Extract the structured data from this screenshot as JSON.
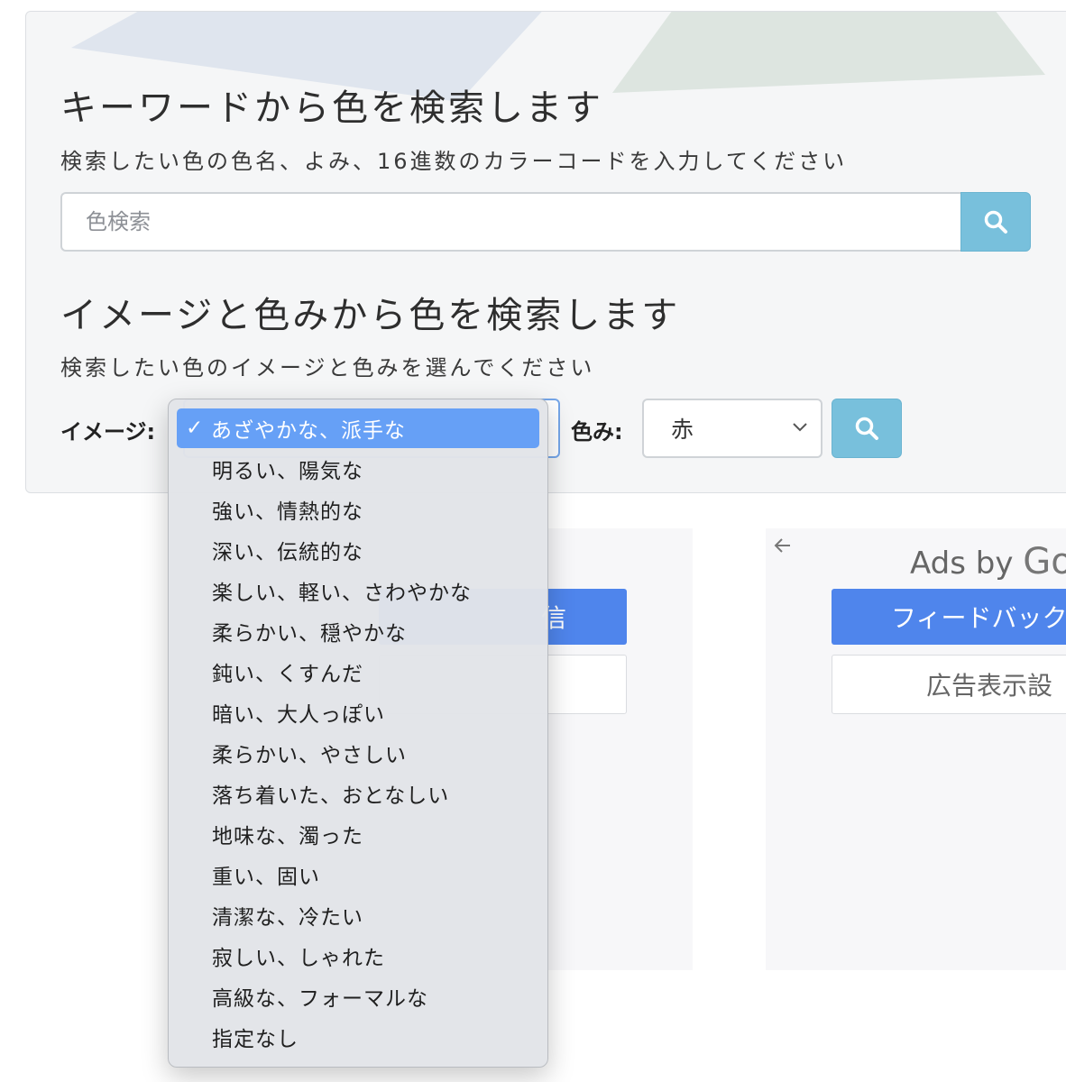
{
  "keyword_search": {
    "title": "キーワードから色を検索します",
    "description": "検索したい色の色名、よみ、16進数のカラーコードを入力してください",
    "input_placeholder": "色検索",
    "button_icon": "search-icon"
  },
  "image_search": {
    "title": "イメージと色みから色を検索します",
    "description": "検索したい色のイメージと色みを選んでください",
    "image_label": "イメージ:",
    "hue_label": "色み:",
    "hue_selected": "赤",
    "button_icon": "search-icon"
  },
  "image_dropdown": {
    "selected_index": 0,
    "check_mark": "✓",
    "options": [
      "あざやかな、派手な",
      "明るい、陽気な",
      "強い、情熱的な",
      "深い、伝統的な",
      "楽しい、軽い、さわやかな",
      "柔らかい、穏やかな",
      "鈍い、くすんだ",
      "暗い、大人っぽい",
      "柔らかい、やさしい",
      "落ち着いた、おとなしい",
      "地味な、濁った",
      "重い、固い",
      "清潔な、冷たい",
      "寂しい、しゃれた",
      "高級な、フォーマルな",
      "指定なし"
    ]
  },
  "ads": {
    "left_button_text": "信",
    "ads_by_prefix": "Ads by ",
    "ads_by_brand": "Go",
    "feedback_button": "フィードバック",
    "settings_button": "広告表示設"
  },
  "colors": {
    "accent": "#78c0dc",
    "dropdown_selected": "#66a0f6",
    "ad_button": "#4f85ec"
  }
}
